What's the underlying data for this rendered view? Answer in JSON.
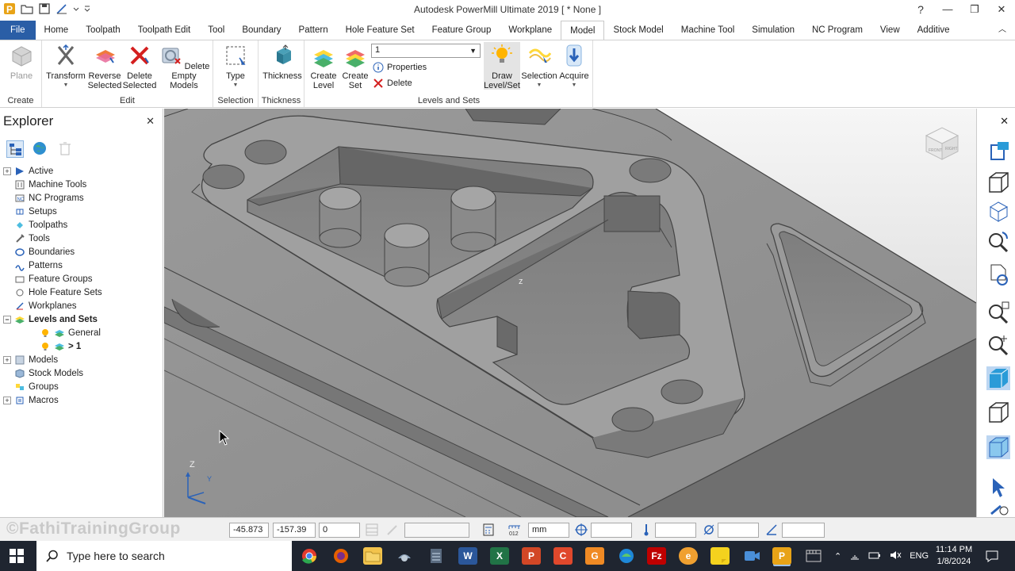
{
  "app": {
    "title": "Autodesk PowerMill Ultimate 2019   [ * None ]"
  },
  "window_controls": {
    "help": "?",
    "minimize": "—",
    "restore": "❐",
    "close": "✕"
  },
  "tabs": [
    {
      "label": "File"
    },
    {
      "label": "Home"
    },
    {
      "label": "Toolpath"
    },
    {
      "label": "Toolpath Edit"
    },
    {
      "label": "Tool"
    },
    {
      "label": "Boundary"
    },
    {
      "label": "Pattern"
    },
    {
      "label": "Hole Feature Set"
    },
    {
      "label": "Feature Group"
    },
    {
      "label": "Workplane"
    },
    {
      "label": "Model"
    },
    {
      "label": "Stock Model"
    },
    {
      "label": "Machine Tool"
    },
    {
      "label": "Simulation"
    },
    {
      "label": "NC Program"
    },
    {
      "label": "View"
    },
    {
      "label": "Additive"
    }
  ],
  "active_tab": "Model",
  "ribbon": {
    "create": {
      "label": "Create",
      "plane": "Plane"
    },
    "edit": {
      "label": "Edit",
      "transform": "Transform",
      "reverse_l1": "Reverse",
      "reverse_l2": "Selected",
      "delete_l1": "Delete",
      "delete_l2": "Selected",
      "delete_empty_l1": "Delete Empty",
      "delete_empty_l2": "Models"
    },
    "selection": {
      "label": "Selection",
      "type": "Type"
    },
    "thickness": {
      "label": "Thickness",
      "thickness": "Thickness"
    },
    "levels": {
      "label": "Levels and Sets",
      "create_level_l1": "Create",
      "create_level_l2": "Level",
      "create_set_l1": "Create",
      "create_set_l2": "Set",
      "level_value": "1",
      "properties": "Properties",
      "delete": "Delete",
      "draw_l1": "Draw",
      "draw_l2": "Level/Set",
      "selection": "Selection",
      "acquire": "Acquire"
    }
  },
  "explorer": {
    "title": "Explorer",
    "close": "✕",
    "tree": [
      {
        "label": "Active"
      },
      {
        "label": "Machine Tools"
      },
      {
        "label": "NC Programs"
      },
      {
        "label": "Setups"
      },
      {
        "label": "Toolpaths"
      },
      {
        "label": "Tools"
      },
      {
        "label": "Boundaries"
      },
      {
        "label": "Patterns"
      },
      {
        "label": "Feature Groups"
      },
      {
        "label": "Hole Feature Sets"
      },
      {
        "label": "Workplanes"
      },
      {
        "label": "Levels and Sets"
      },
      {
        "label": "General"
      },
      {
        "label": "> 1"
      },
      {
        "label": "Models"
      },
      {
        "label": "Stock Models"
      },
      {
        "label": "Groups"
      },
      {
        "label": "Macros"
      }
    ]
  },
  "viewport": {
    "axis_z": "Z",
    "axis_y": "Y",
    "center_marker": "z",
    "viewcube": {
      "front": "FRONT",
      "right": "RIGHT"
    }
  },
  "status": {
    "watermark": "©FathiTrainingGroup",
    "x": "-45.873",
    "y": "-157.39",
    "z": "0",
    "units": "mm"
  },
  "taskbar": {
    "search_placeholder": "Type here to search",
    "lang": "ENG",
    "time": "11:14 PM",
    "date": "1/8/2024"
  },
  "colors": {
    "file_tab": "#2a5ea6",
    "model_face": "#8c8c8c",
    "taskbar": "#1f2530",
    "accent_blue": "#1e88d8"
  }
}
